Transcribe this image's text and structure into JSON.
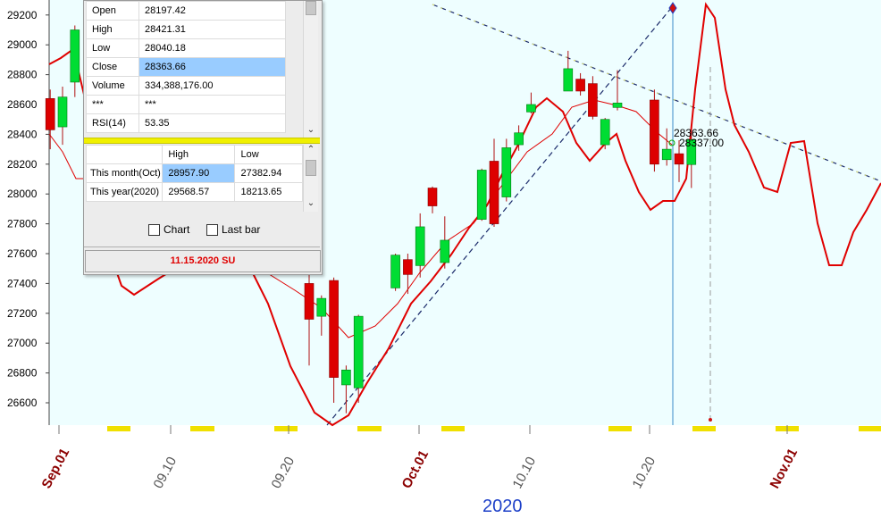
{
  "chart_data": {
    "type": "candlestick",
    "ylim": [
      26450,
      29300
    ],
    "y_ticks": [
      26600,
      26800,
      27000,
      27200,
      27400,
      27600,
      27800,
      28000,
      28200,
      28400,
      28600,
      28800,
      29000,
      29200
    ],
    "x_labels": [
      {
        "label": "Sep.01",
        "bold": true
      },
      {
        "label": "09.10",
        "bold": false
      },
      {
        "label": "09.20",
        "bold": false
      },
      {
        "label": "Oct.01",
        "bold": true
      },
      {
        "label": "10.10",
        "bold": false
      },
      {
        "label": "10.20",
        "bold": false
      },
      {
        "label": "Nov.01",
        "bold": true
      }
    ],
    "year_label": "2020",
    "candles": [
      {
        "date": "08.31",
        "open": 28640,
        "high": 28700,
        "low": 28300,
        "close": 28430
      },
      {
        "date": "09.01",
        "open": 28450,
        "high": 28720,
        "low": 28330,
        "close": 28650
      },
      {
        "date": "09.02",
        "open": 28750,
        "high": 29130,
        "low": 28650,
        "close": 29100
      },
      {
        "date": "09.21",
        "open": 27400,
        "high": 27520,
        "low": 26850,
        "close": 27160
      },
      {
        "date": "09.22",
        "open": 27180,
        "high": 27320,
        "low": 27050,
        "close": 27300
      },
      {
        "date": "09.23",
        "open": 27420,
        "high": 27440,
        "low": 26600,
        "close": 26770
      },
      {
        "date": "09.24",
        "open": 26720,
        "high": 26850,
        "low": 26530,
        "close": 26820
      },
      {
        "date": "09.25",
        "open": 26700,
        "high": 27190,
        "low": 26600,
        "close": 27180
      },
      {
        "date": "09.28",
        "open": 27370,
        "high": 27600,
        "low": 27350,
        "close": 27590
      },
      {
        "date": "09.29",
        "open": 27560,
        "high": 27600,
        "low": 27330,
        "close": 27460
      },
      {
        "date": "09.30",
        "open": 27520,
        "high": 27870,
        "low": 27440,
        "close": 27780
      },
      {
        "date": "10.01",
        "open": 28040,
        "high": 28050,
        "low": 27870,
        "close": 27920
      },
      {
        "date": "10.02",
        "open": 27540,
        "high": 27850,
        "low": 27500,
        "close": 27690
      },
      {
        "date": "10.05",
        "open": 27830,
        "high": 28170,
        "low": 27820,
        "close": 28160
      },
      {
        "date": "10.06",
        "open": 28220,
        "high": 28370,
        "low": 27780,
        "close": 27800
      },
      {
        "date": "10.07",
        "open": 27980,
        "high": 28370,
        "low": 27950,
        "close": 28310
      },
      {
        "date": "10.08",
        "open": 28330,
        "high": 28460,
        "low": 28290,
        "close": 28410
      },
      {
        "date": "10.09",
        "open": 28550,
        "high": 28680,
        "low": 28540,
        "close": 28600
      },
      {
        "date": "10.12",
        "open": 28690,
        "high": 28960,
        "low": 28690,
        "close": 28840
      },
      {
        "date": "10.13",
        "open": 28770,
        "high": 28810,
        "low": 28660,
        "close": 28690
      },
      {
        "date": "10.14",
        "open": 28740,
        "high": 28790,
        "low": 28500,
        "close": 28520
      },
      {
        "date": "10.15",
        "open": 28330,
        "high": 28510,
        "low": 28300,
        "close": 28500
      },
      {
        "date": "10.16",
        "open": 28580,
        "high": 28830,
        "low": 28560,
        "close": 28610
      },
      {
        "date": "10.19",
        "open": 28630,
        "high": 28700,
        "low": 28150,
        "close": 28200
      },
      {
        "date": "10.20",
        "open": 28230,
        "high": 28440,
        "low": 28190,
        "close": 28300
      },
      {
        "date": "10.21",
        "open": 28270,
        "high": 28360,
        "low": 28080,
        "close": 28200
      },
      {
        "date": "10.22",
        "open": 28197.42,
        "high": 28421.31,
        "low": 28040.18,
        "close": 28363.66
      }
    ],
    "price_labels": [
      "28363.66",
      "28337.00"
    ]
  },
  "data_window": {
    "rows": [
      {
        "key": "Open",
        "value": "28197.42"
      },
      {
        "key": "High",
        "value": "28421.31"
      },
      {
        "key": "Low",
        "value": "28040.18"
      },
      {
        "key": "Close",
        "value": "28363.66"
      },
      {
        "key": "Volume",
        "value": "334,388,176.00"
      },
      {
        "key": "***",
        "value": "***"
      },
      {
        "key": "RSI(14)",
        "value": "53.35"
      }
    ],
    "range_header": {
      "high": "High",
      "low": "Low"
    },
    "ranges": [
      {
        "label": "This month(Oct)",
        "high": "28957.90",
        "low": "27382.94"
      },
      {
        "label": "This year(2020)",
        "high": "29568.57",
        "low": "18213.65"
      }
    ],
    "chart_checkbox": "Chart",
    "lastbar_checkbox": "Last bar",
    "status": "11.15.2020 SU"
  },
  "colors": {
    "up": "#00dd33",
    "down": "#dd0000",
    "bg": "#eefeff",
    "ma": "#e00000"
  }
}
